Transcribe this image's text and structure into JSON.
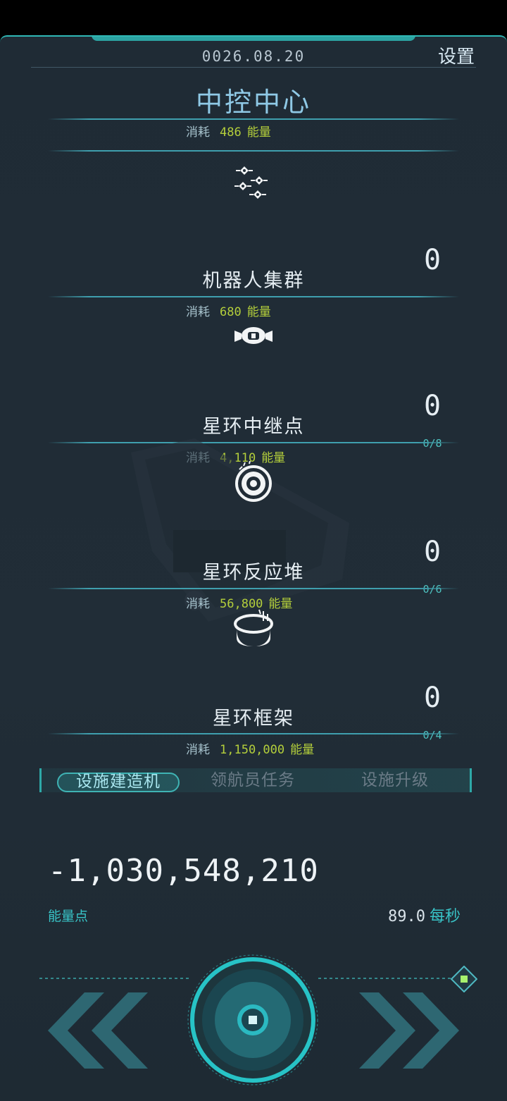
{
  "header": {
    "date": "0026.08.20",
    "settings_label": "设置",
    "title": "中控中心"
  },
  "items": [
    {
      "name": "",
      "cost_label": "消耗",
      "cost_value": "486",
      "cost_unit": "能量",
      "count": "",
      "ratio": "",
      "icon": "partial-hidden"
    },
    {
      "name": "机器人集群",
      "cost_label": "消耗",
      "cost_value": "680",
      "cost_unit": "能量",
      "count": "0",
      "ratio": "",
      "icon": "robot-swarm-icon"
    },
    {
      "name": "星环中继点",
      "cost_label": "消耗",
      "cost_value": "4,110",
      "cost_unit": "能量",
      "count": "0",
      "ratio": "0/8",
      "icon": "relay-station-icon"
    },
    {
      "name": "星环反应堆",
      "cost_label": "消耗",
      "cost_value": "56,800",
      "cost_unit": "能量",
      "count": "0",
      "ratio": "0/6",
      "icon": "reactor-icon"
    },
    {
      "name": "星环框架",
      "cost_label": "消耗",
      "cost_value": "1,150,000",
      "cost_unit": "能量",
      "count": "0",
      "ratio": "0/4",
      "icon": "ring-frame-icon"
    }
  ],
  "tabs": [
    "设施建造机",
    "领航员任务",
    "设施升级"
  ],
  "energy": {
    "value": "-1,030,548,210",
    "label": "能量点",
    "rate_value": "89.0",
    "rate_unit": "每秒"
  },
  "controls": {
    "left_icon": "double-chevron-left-icon",
    "right_icon": "double-chevron-right-icon",
    "center_icon": "main-action-icon",
    "corner_icon": "diamond-indicator-icon"
  },
  "colors": {
    "accent": "#2fb8b5",
    "cost_value": "#b4cf3b",
    "background": "#202c36"
  }
}
